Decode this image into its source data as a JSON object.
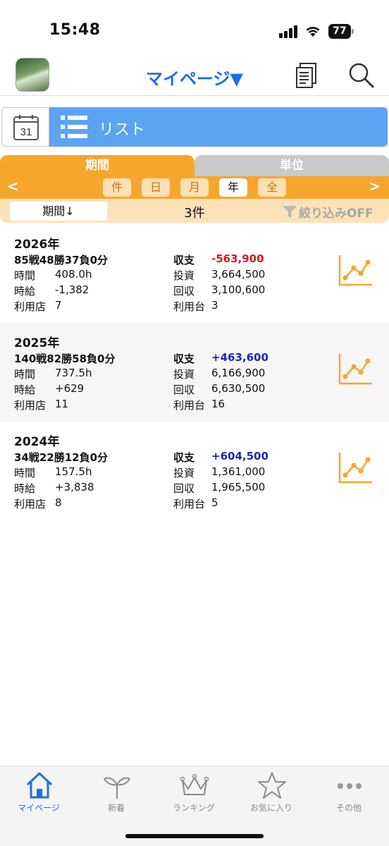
{
  "status_bar": {
    "time": "15:48",
    "battery": "77"
  },
  "header": {
    "title": "マイページ▼",
    "logo_text": ""
  },
  "view_selector": {
    "calendar_day": "31",
    "list_label": "リスト"
  },
  "tabs": {
    "period": "期間",
    "unit": "単位"
  },
  "period_nav": {
    "prev": "<",
    "next": ">",
    "options": [
      "件",
      "日",
      "月",
      "年",
      "全"
    ],
    "selected": "年"
  },
  "filter_row": {
    "sort_label": "期間↓",
    "count": "3件",
    "filter_label": "絞り込みOFF"
  },
  "labels": {
    "time": "時間",
    "hourly": "時給",
    "stores": "利用店",
    "balance": "収支",
    "invest": "投資",
    "collect": "回収",
    "machines": "利用台"
  },
  "records": [
    {
      "year": "2026年",
      "record": "85戦48勝37負0分",
      "time": "408.0h",
      "hourly": "-1,382",
      "stores": "7",
      "balance": "-563,900",
      "balance_sign": "negative",
      "invest": "3,664,500",
      "collect": "3,100,600",
      "machines": "3"
    },
    {
      "year": "2025年",
      "record": "140戦82勝58負0分",
      "time": "737.5h",
      "hourly": "+629",
      "stores": "11",
      "balance": "+463,600",
      "balance_sign": "positive",
      "invest": "6,166,900",
      "collect": "6,630,500",
      "machines": "16"
    },
    {
      "year": "2024年",
      "record": "34戦22勝12負0分",
      "time": "157.5h",
      "hourly": "+3,838",
      "stores": "8",
      "balance": "+604,500",
      "balance_sign": "positive",
      "invest": "1,361,000",
      "collect": "1,965,500",
      "machines": "5"
    }
  ],
  "tab_bar": {
    "items": [
      {
        "label": "マイページ",
        "icon": "home-icon",
        "active": true
      },
      {
        "label": "新着",
        "icon": "sprout-icon",
        "active": false
      },
      {
        "label": "ランキング",
        "icon": "crown-icon",
        "active": false
      },
      {
        "label": "お気に入り",
        "icon": "star-icon",
        "active": false
      },
      {
        "label": "その他",
        "icon": "more-icon",
        "active": false
      }
    ]
  },
  "colors": {
    "accent": "#f6a62d",
    "link": "#1d6fe0",
    "list_bg": "#5ba4f2",
    "negative": "#e0161b",
    "positive": "#1f24b8"
  }
}
